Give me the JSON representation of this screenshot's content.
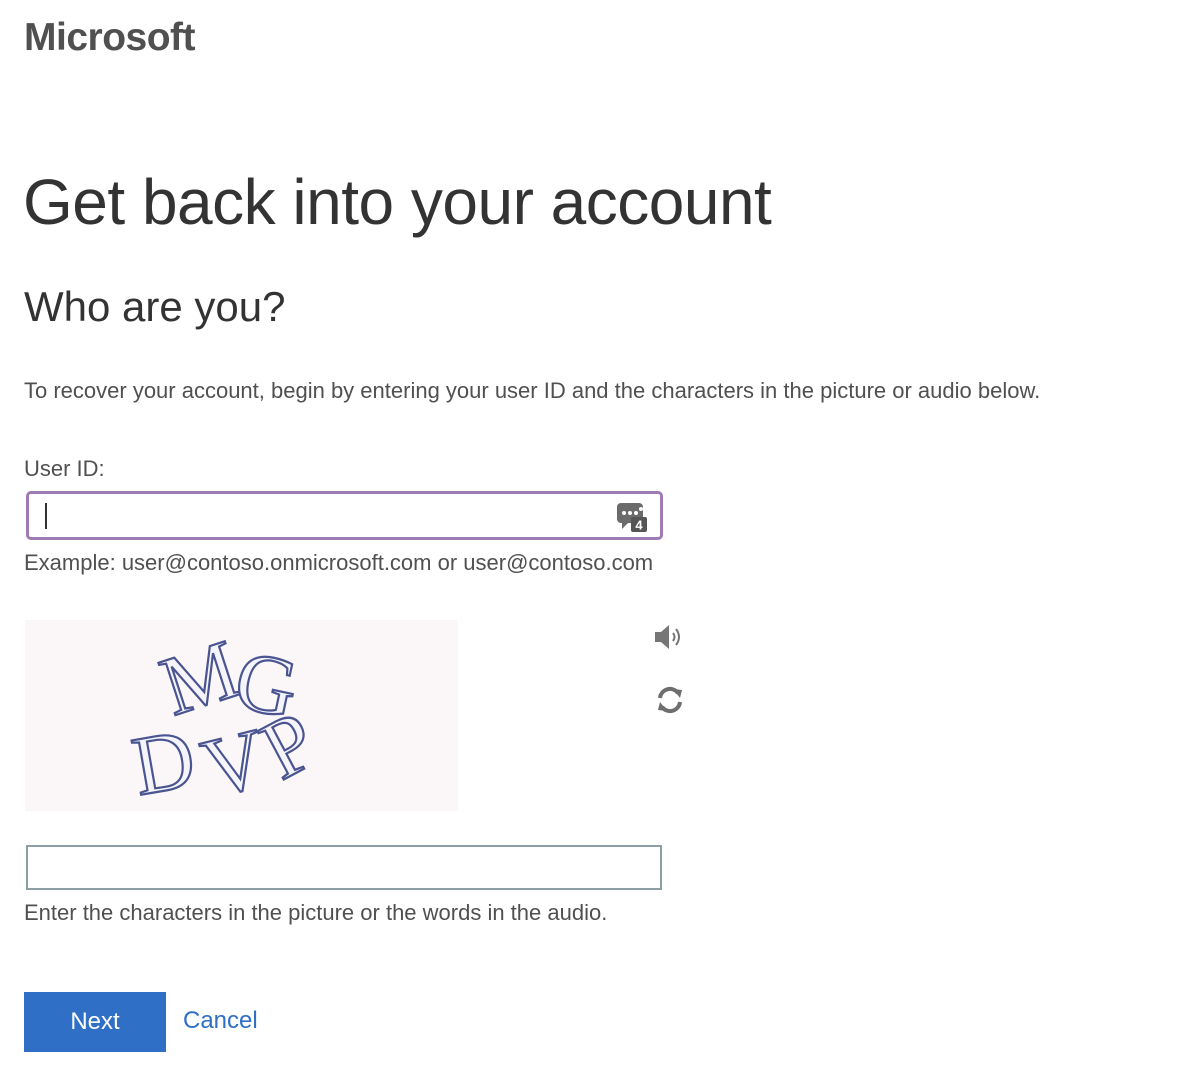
{
  "brand": {
    "logo_text": "Microsoft"
  },
  "page": {
    "title": "Get back into your account",
    "section_title": "Who are you?",
    "instructions": "To recover your account, begin by entering your user ID and the characters in the picture or audio below."
  },
  "user_id": {
    "label": "User ID:",
    "value": "",
    "placeholder": "",
    "example": "Example: user@contoso.onmicrosoft.com or user@contoso.com",
    "password_manager_badge": "4"
  },
  "captcha": {
    "image_characters": "MGDVP",
    "audio_icon": "speaker-icon",
    "refresh_icon": "refresh-icon",
    "input_value": "",
    "help_text": "Enter the characters in the picture or the words in the audio."
  },
  "actions": {
    "next_label": "Next",
    "cancel_label": "Cancel"
  },
  "colors": {
    "primary": "#2f6fc5",
    "focus_border": "#a07ab2",
    "captcha_ink": "#4a5490"
  }
}
